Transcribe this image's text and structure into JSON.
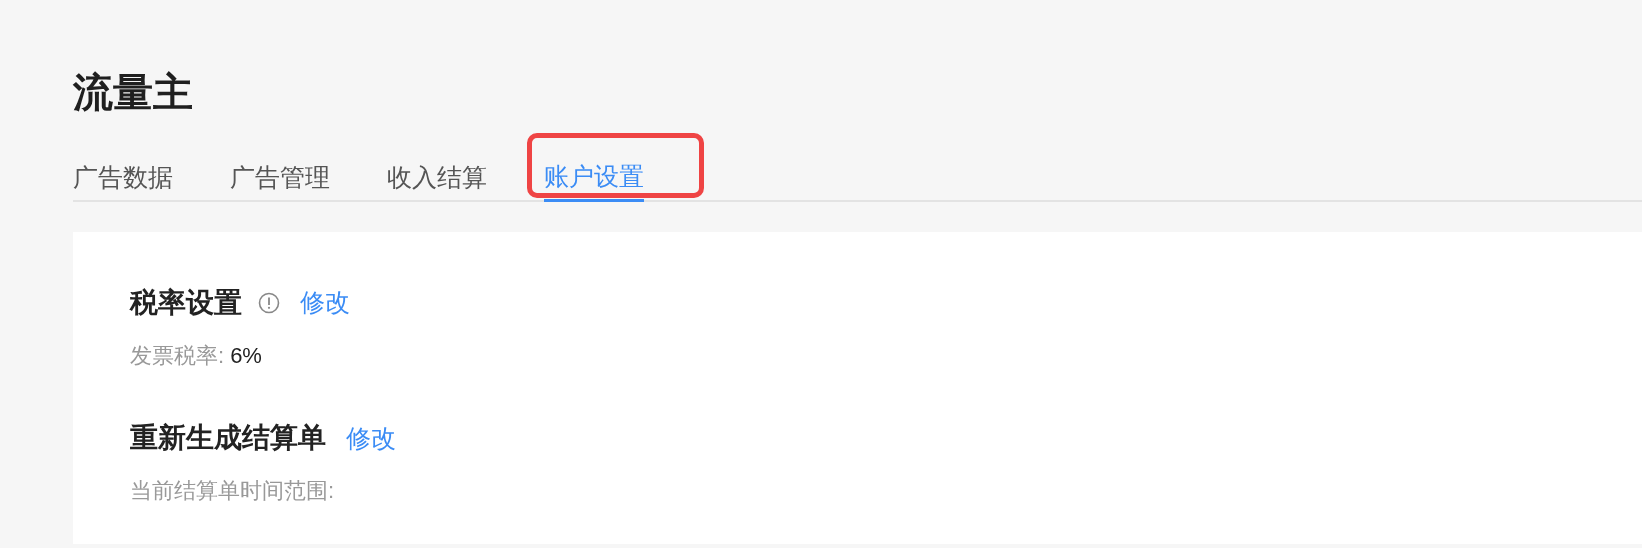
{
  "page_title": "流量主",
  "tabs": [
    {
      "label": "广告数据",
      "selected": false,
      "highlighted": false
    },
    {
      "label": "广告管理",
      "selected": false,
      "highlighted": false
    },
    {
      "label": "收入结算",
      "selected": false,
      "highlighted": false
    },
    {
      "label": "账户设置",
      "selected": true,
      "highlighted": true
    }
  ],
  "sections": [
    {
      "title": "税率设置",
      "info_icon": true,
      "action": "修改",
      "fields": [
        {
          "label": "发票税率:",
          "value": "6%"
        }
      ]
    },
    {
      "title": "重新生成结算单",
      "info_icon": false,
      "action": "修改",
      "fields": [
        {
          "label": "当前结算单时间范围:"
        }
      ]
    }
  ]
}
